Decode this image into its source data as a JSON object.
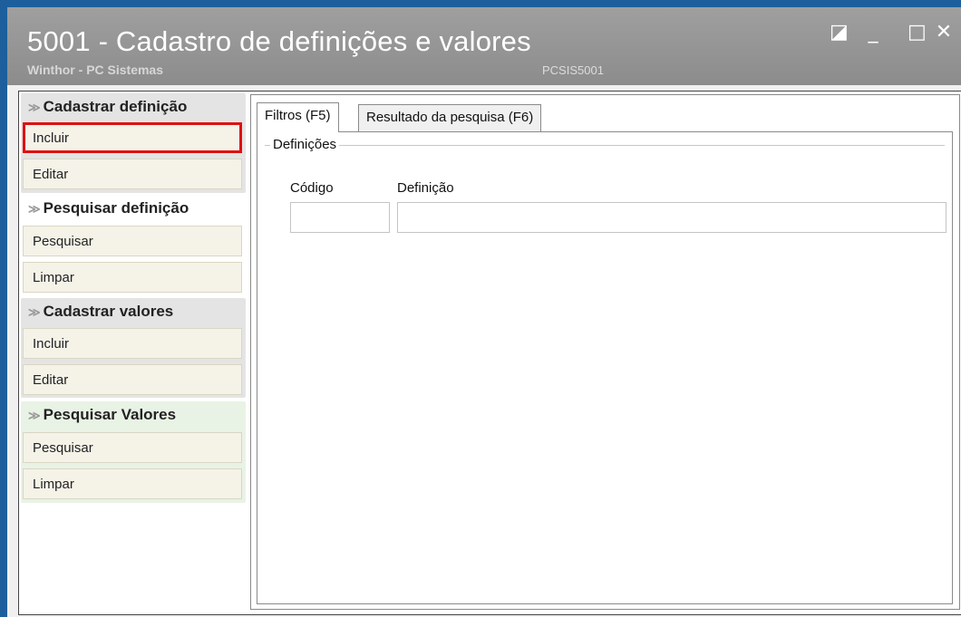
{
  "window": {
    "title": "5001 - Cadastro de definições e valores",
    "subtitle": "Winthor - PC Sistemas",
    "code": "PCSIS5001",
    "controls": {
      "restore": "◪",
      "minimize": "_",
      "maximize": "□",
      "close": "✕"
    }
  },
  "sidebar": {
    "groups": [
      {
        "title": "Cadastrar definição",
        "items": [
          "Incluir",
          "Editar"
        ]
      },
      {
        "title": "Pesquisar definição",
        "items": [
          "Pesquisar",
          "Limpar"
        ]
      },
      {
        "title": "Cadastrar valores",
        "items": [
          "Incluir",
          "Editar"
        ]
      },
      {
        "title": "Pesquisar Valores",
        "items": [
          "Pesquisar",
          "Limpar"
        ]
      }
    ],
    "chevron": "≫",
    "highlight_color": "#e01010"
  },
  "tabs": [
    {
      "label": "Filtros (F5)"
    },
    {
      "label": "Resultado da pesquisa (F6)"
    }
  ],
  "filters": {
    "group_title": "Definições",
    "codigo_label": "Código",
    "codigo_value": "",
    "definicao_label": "Definição",
    "definicao_value": ""
  }
}
